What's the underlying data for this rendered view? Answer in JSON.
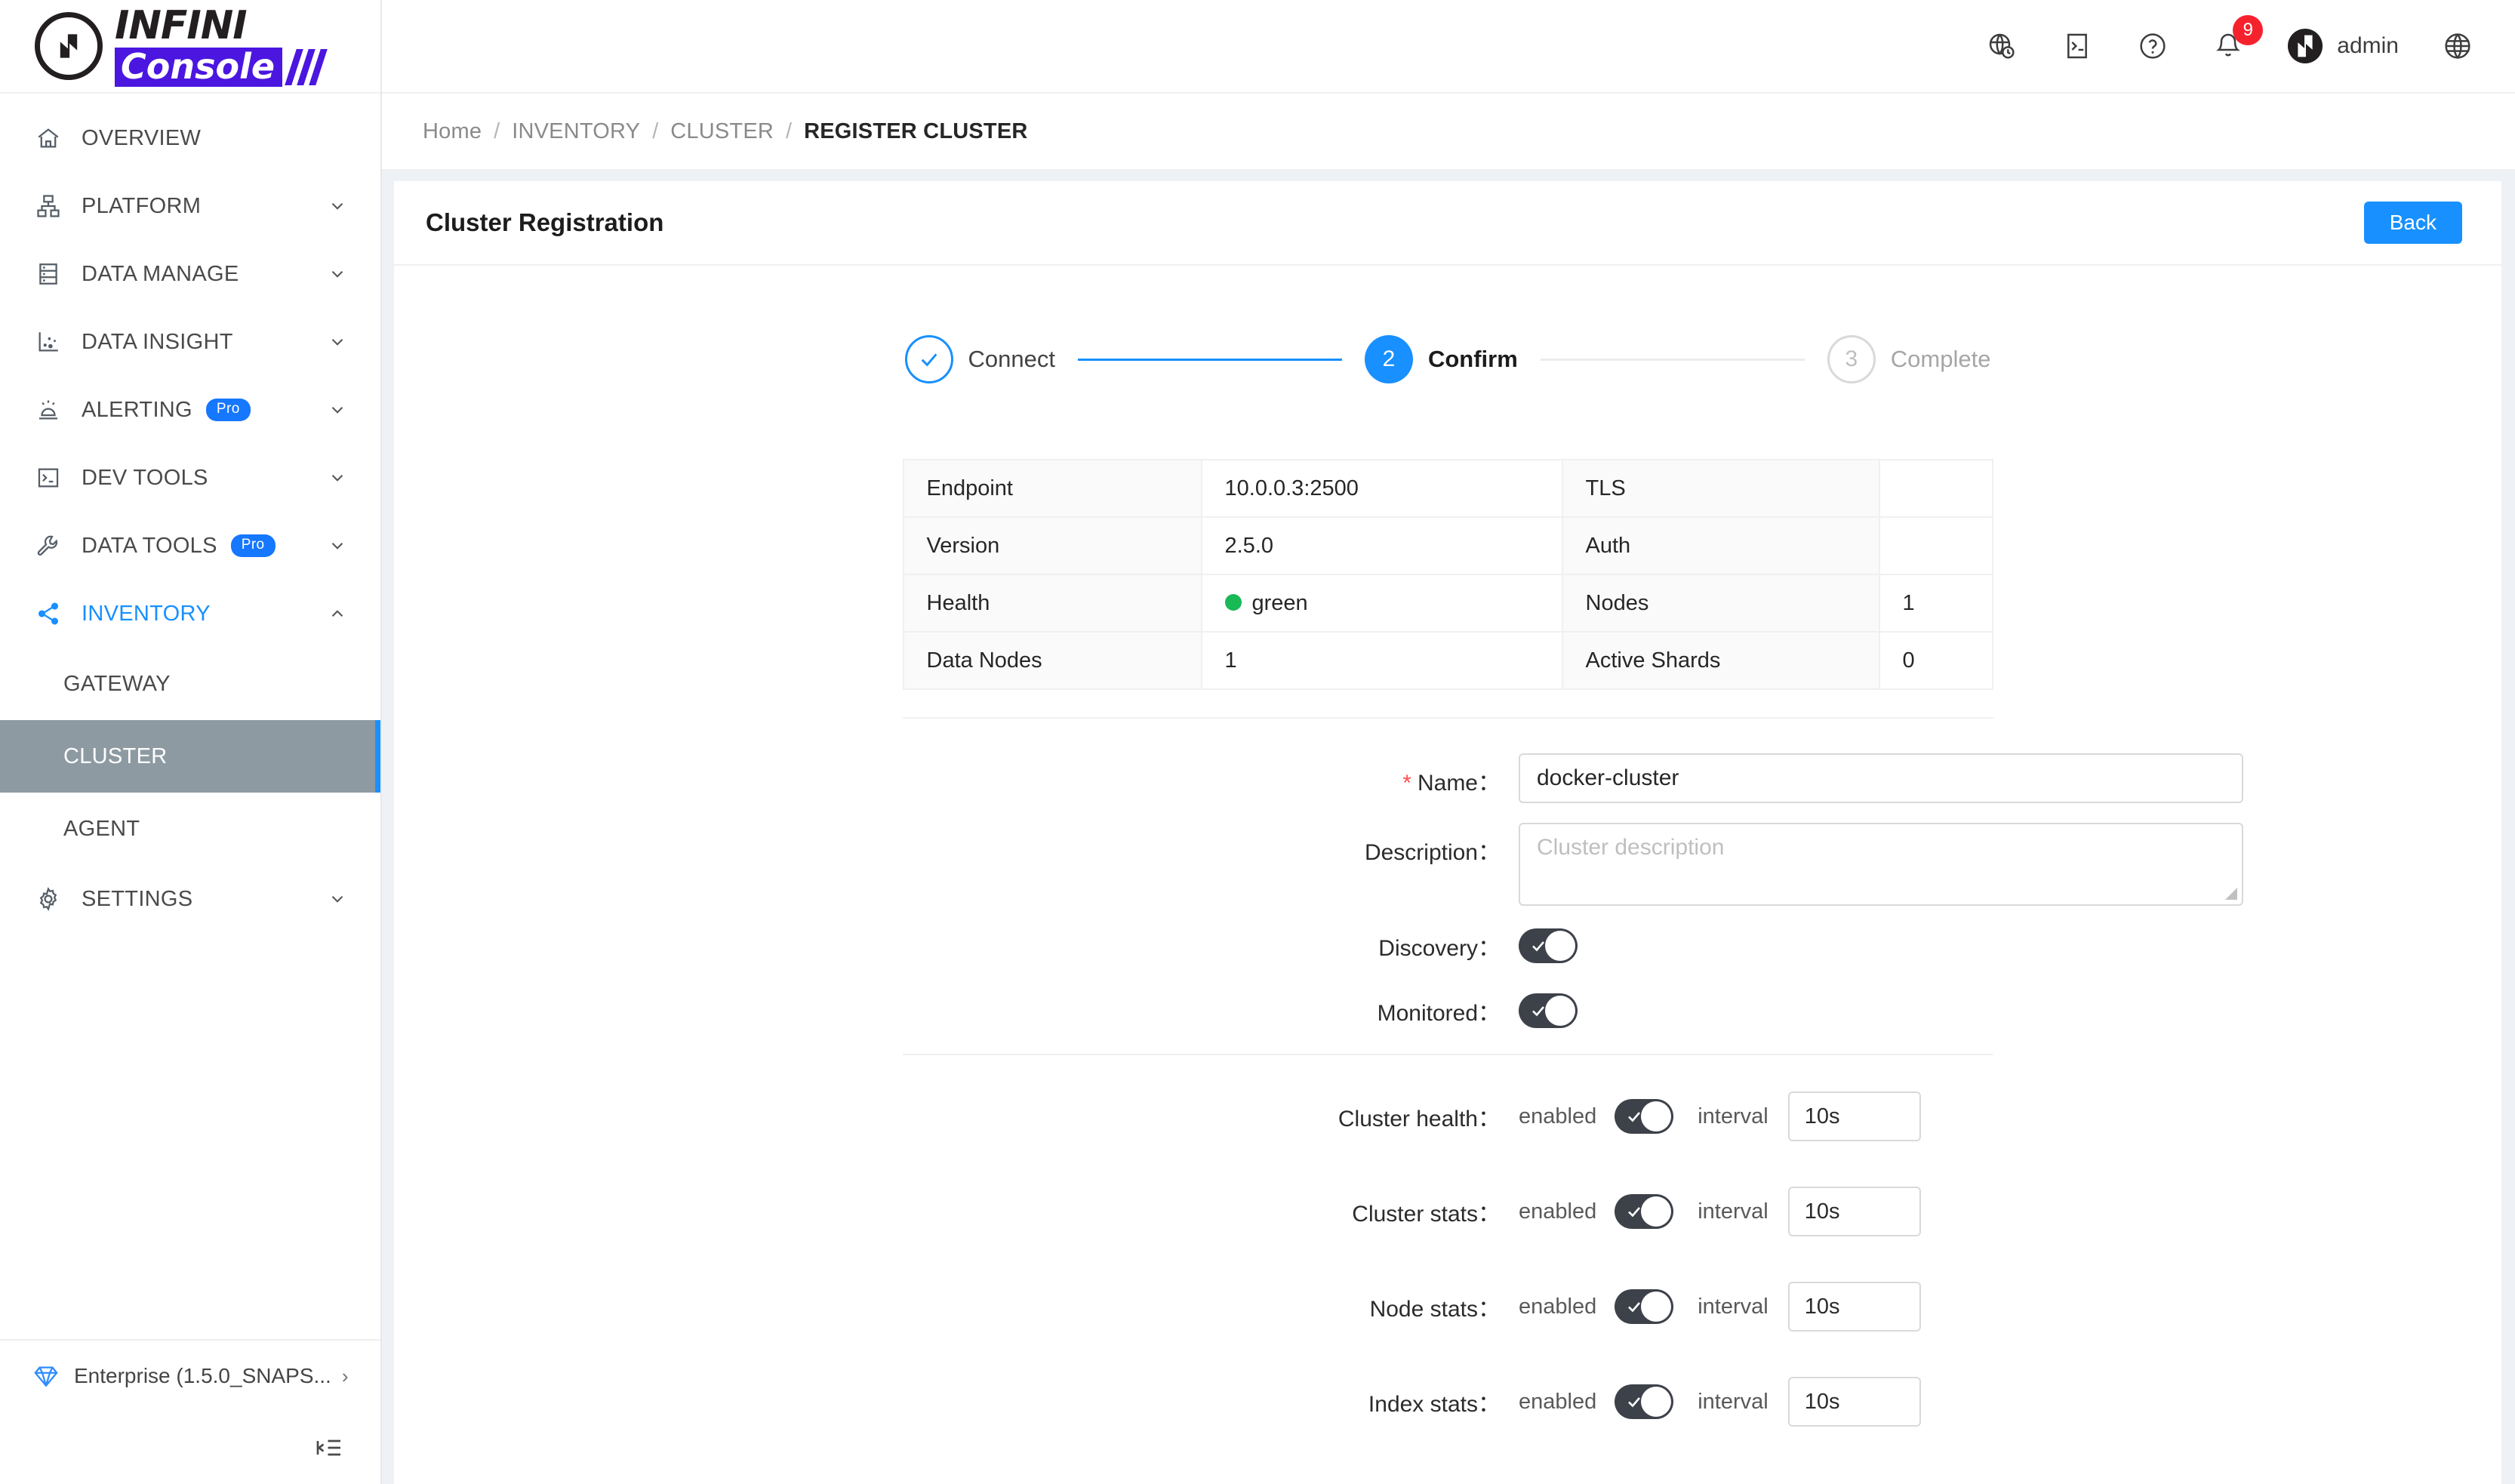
{
  "brand": {
    "name_top": "INFINI",
    "name_bottom": "Console"
  },
  "sidebar": {
    "items": [
      {
        "label": "OVERVIEW",
        "icon": "home-icon",
        "expandable": false,
        "badge": null
      },
      {
        "label": "PLATFORM",
        "icon": "platform-icon",
        "expandable": true,
        "badge": null
      },
      {
        "label": "DATA MANAGE",
        "icon": "database-icon",
        "expandable": true,
        "badge": null
      },
      {
        "label": "DATA INSIGHT",
        "icon": "scatter-icon",
        "expandable": true,
        "badge": null
      },
      {
        "label": "ALERTING",
        "icon": "alarm-icon",
        "expandable": true,
        "badge": "Pro"
      },
      {
        "label": "DEV TOOLS",
        "icon": "terminal-icon",
        "expandable": true,
        "badge": null
      },
      {
        "label": "DATA TOOLS",
        "icon": "wrench-icon",
        "expandable": true,
        "badge": "Pro"
      },
      {
        "label": "INVENTORY",
        "icon": "share-icon",
        "expandable": true,
        "badge": null,
        "active": true,
        "expanded": true
      },
      {
        "label": "SETTINGS",
        "icon": "gear-icon",
        "expandable": true,
        "badge": null
      }
    ],
    "sub_items": [
      {
        "label": "GATEWAY",
        "selected": false
      },
      {
        "label": "CLUSTER",
        "selected": true
      },
      {
        "label": "AGENT",
        "selected": false
      }
    ],
    "footer": {
      "label": "Enterprise (1.5.0_SNAPS...",
      "icon": "gem-icon",
      "arrow": "›"
    },
    "collapse_icon": "collapse-sidebar-icon"
  },
  "topbar": {
    "icons": [
      {
        "name": "globe-clock-icon"
      },
      {
        "name": "terminal-icon"
      },
      {
        "name": "help-circle-icon"
      },
      {
        "name": "bell-icon",
        "badge": "9"
      }
    ],
    "user": "admin",
    "language_icon": "globe-icon"
  },
  "breadcrumb": {
    "items": [
      "Home",
      "INVENTORY",
      "CLUSTER",
      "REGISTER CLUSTER"
    ],
    "separator": "/"
  },
  "page": {
    "title": "Cluster Registration",
    "back_label": "Back"
  },
  "stepper": {
    "steps": [
      {
        "num": "1",
        "label": "Connect",
        "state": "done"
      },
      {
        "num": "2",
        "label": "Confirm",
        "state": "current"
      },
      {
        "num": "3",
        "label": "Complete",
        "state": "todo"
      }
    ]
  },
  "info_table": {
    "rows": [
      {
        "label": "Endpoint",
        "value": "10.0.0.3:2500",
        "label2": "TLS",
        "value2": ""
      },
      {
        "label": "Version",
        "value": "2.5.0",
        "label2": "Auth",
        "value2": ""
      },
      {
        "label": "Health",
        "value": "green",
        "label2": "Nodes",
        "value2": "1",
        "health_dot": "#19b955"
      },
      {
        "label": "Data Nodes",
        "value": "1",
        "label2": "Active Shards",
        "value2": "0"
      }
    ]
  },
  "form": {
    "name_label": "Name：",
    "name_value": "docker-cluster",
    "name_required": "*",
    "description_label": "Description：",
    "description_placeholder": "Cluster description",
    "description_value": "",
    "discovery_label": "Discovery：",
    "discovery_on": true,
    "monitored_label": "Monitored：",
    "monitored_on": true
  },
  "metrics": {
    "enabled_word": "enabled",
    "interval_word": "interval",
    "rows": [
      {
        "label": "Cluster health：",
        "enabled": true,
        "interval": "10s"
      },
      {
        "label": "Cluster stats：",
        "enabled": true,
        "interval": "10s"
      },
      {
        "label": "Node stats：",
        "enabled": true,
        "interval": "10s"
      },
      {
        "label": "Index stats：",
        "enabled": true,
        "interval": "10s"
      }
    ]
  },
  "colors": {
    "accent": "#1890ff",
    "brand_purple": "#4b16e0",
    "pro_badge": "#1677ff",
    "health_green": "#19b955",
    "badge_red": "#f5222d",
    "selected_sub": "#8e9aa2",
    "toggle_on": "#3d4149"
  }
}
